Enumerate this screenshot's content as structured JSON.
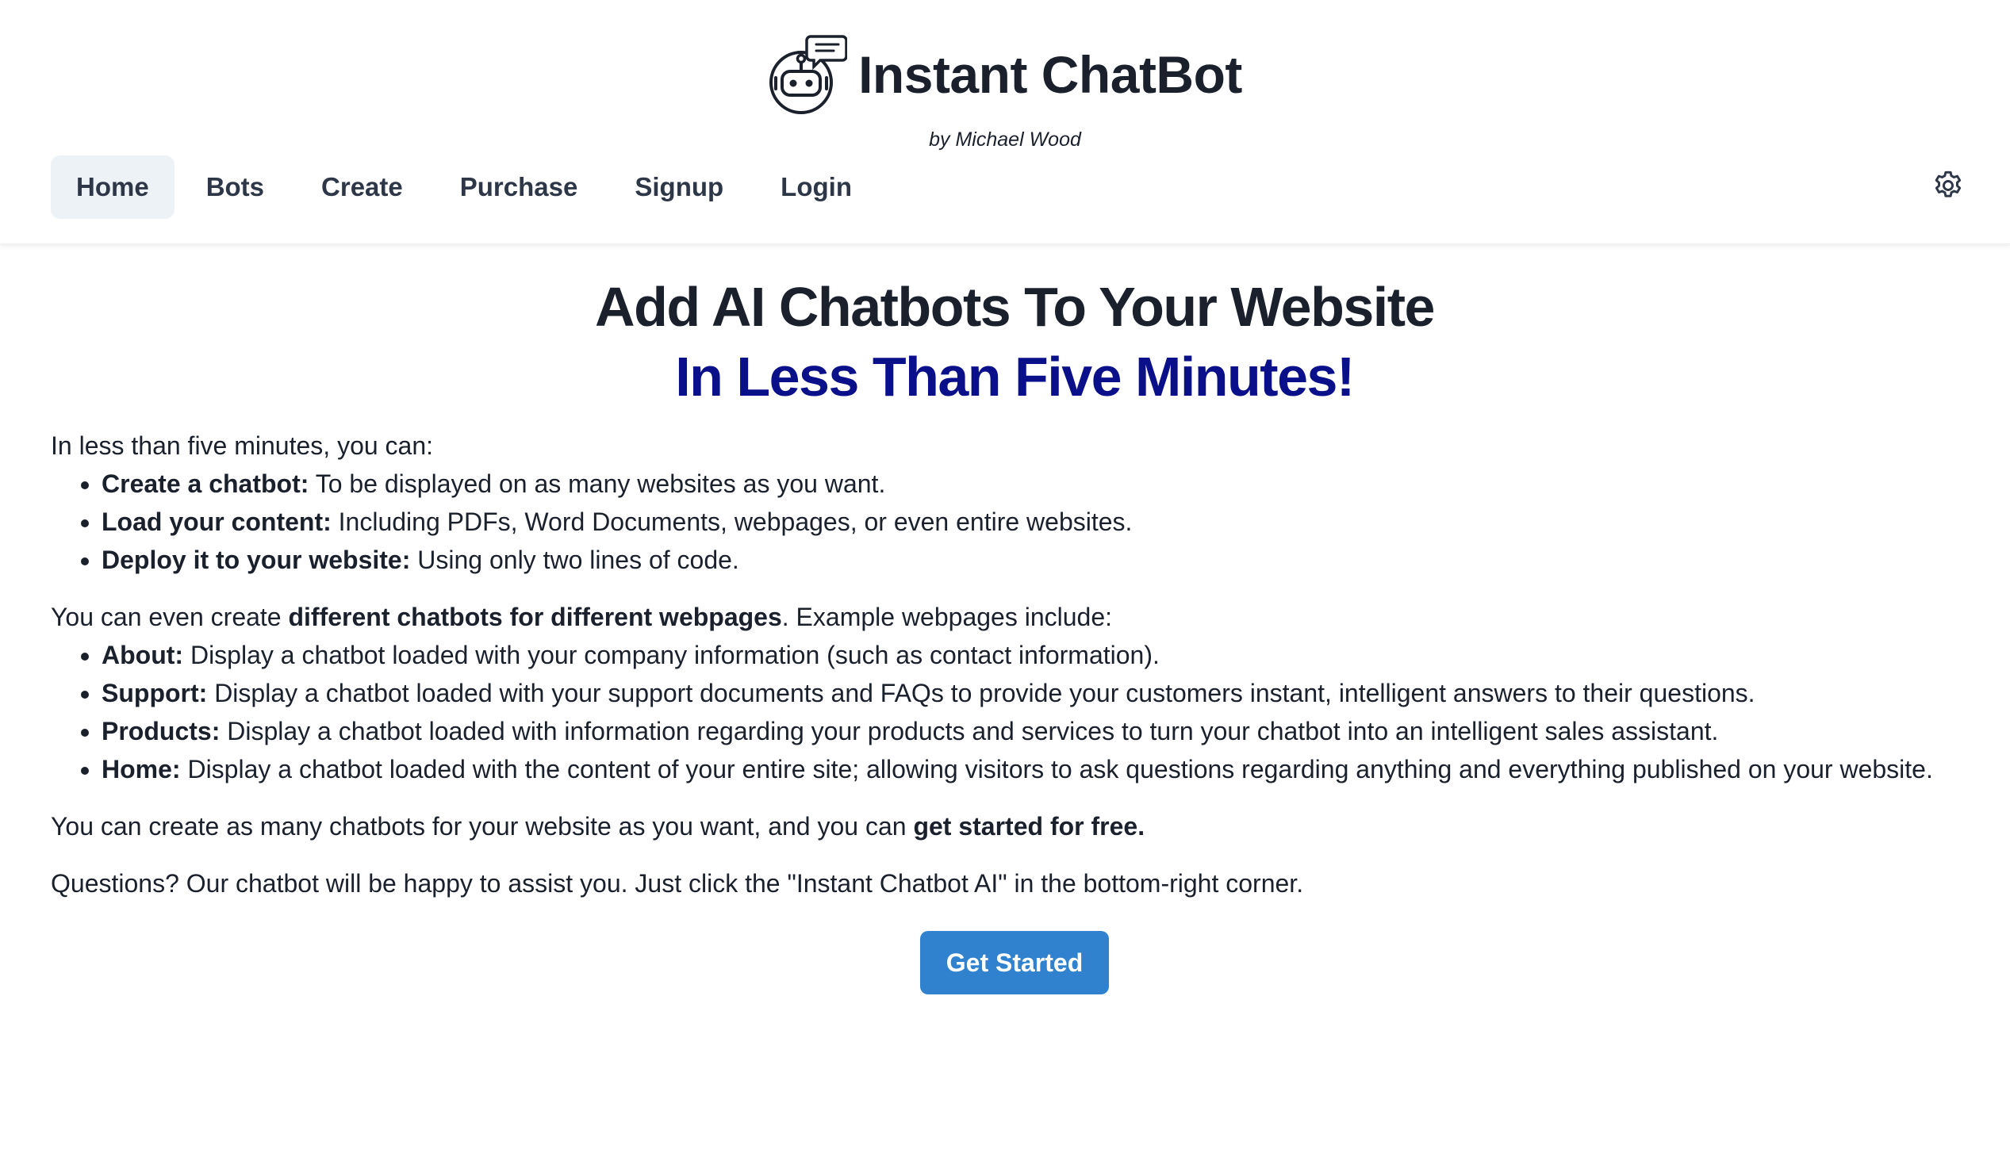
{
  "brand": {
    "title": "Instant ChatBot",
    "byline": "by Michael Wood",
    "logo_icon": "robot-chat-icon"
  },
  "nav": {
    "items": [
      {
        "label": "Home",
        "active": true
      },
      {
        "label": "Bots",
        "active": false
      },
      {
        "label": "Create",
        "active": false
      },
      {
        "label": "Purchase",
        "active": false
      },
      {
        "label": "Signup",
        "active": false
      },
      {
        "label": "Login",
        "active": false
      }
    ],
    "settings_icon": "gear-icon"
  },
  "hero": {
    "line1": "Add AI Chatbots To Your Website",
    "line2": "In Less Than Five Minutes!"
  },
  "intro": {
    "lead": "In less than five minutes, you can:",
    "bullets": [
      {
        "bold": "Create a chatbot:",
        "text": " To be displayed on as many websites as you want."
      },
      {
        "bold": "Load your content:",
        "text": " Including PDFs, Word Documents, webpages, or even entire websites."
      },
      {
        "bold": "Deploy it to your website:",
        "text": " Using only two lines of code."
      }
    ]
  },
  "examples": {
    "lead_pre": "You can even create ",
    "lead_bold": "different chatbots for different webpages",
    "lead_post": ". Example webpages include:",
    "bullets": [
      {
        "bold": "About:",
        "text": " Display a chatbot loaded with your company information (such as contact information)."
      },
      {
        "bold": "Support:",
        "text": " Display a chatbot loaded with your support documents and FAQs to provide your customers instant, intelligent answers to their questions."
      },
      {
        "bold": "Products:",
        "text": " Display a chatbot loaded with information regarding your products and services to turn your chatbot into an intelligent sales assistant."
      },
      {
        "bold": "Home:",
        "text": " Display a chatbot loaded with the content of your entire site; allowing visitors to ask questions regarding anything and everything published on your website."
      }
    ]
  },
  "free": {
    "pre": "You can create as many chatbots for your website as you want, and you can ",
    "bold": "get started for free."
  },
  "questions": "Questions? Our chatbot will be happy to assist you. Just click the \"Instant Chatbot AI\" in the bottom-right corner.",
  "cta": {
    "label": "Get Started"
  },
  "colors": {
    "accent": "#3182ce",
    "headline_blue": "#0a0f8a",
    "nav_active_bg": "#edf2f7",
    "text": "#1a202c"
  }
}
